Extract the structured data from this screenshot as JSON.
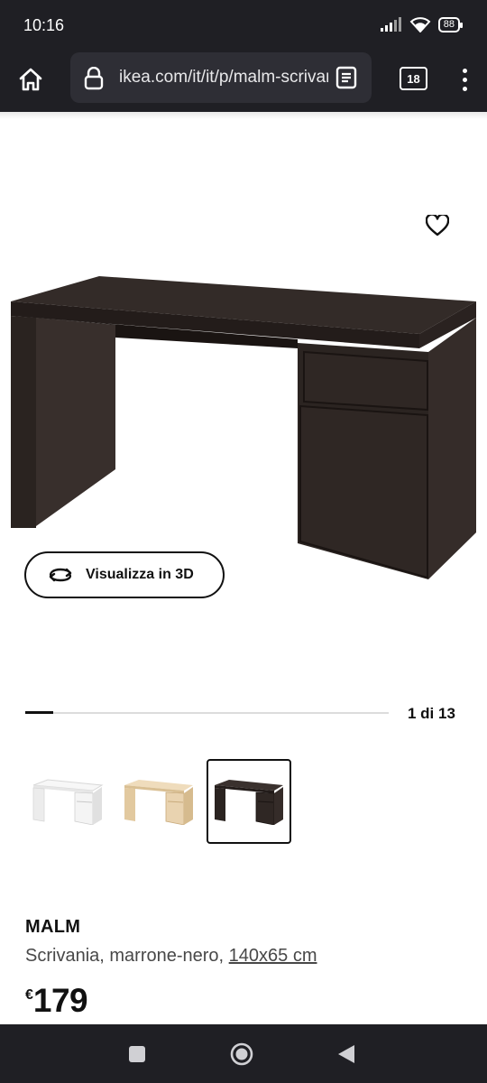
{
  "status_bar": {
    "time": "10:16",
    "battery": "88"
  },
  "browser": {
    "url": "ikea.com/it/it/p/malm-scrivania-marrone-nero",
    "tab_count": "18"
  },
  "product": {
    "view_3d_label": "Visualizza in 3D",
    "gallery_position": "1 di 13",
    "gallery_progress": 0.077,
    "name": "MALM",
    "description": "Scrivania, marrone-nero, ",
    "dimensions": "140x65 cm",
    "currency": "€",
    "price": "179",
    "variants": [
      {
        "color": "bianco",
        "hex": "#f4f4f4",
        "selected": false
      },
      {
        "color": "impiallacciatura rovere mordente bianco",
        "hex": "#e9d3b0",
        "selected": false
      },
      {
        "color": "marrone-nero",
        "hex": "#2f2724",
        "selected": true
      }
    ]
  },
  "colors": {
    "system_bar": "#1f1f24",
    "desk": "#2f2724"
  }
}
